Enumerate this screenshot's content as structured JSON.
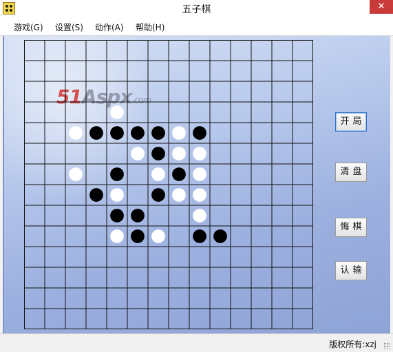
{
  "window": {
    "title": "五子棋",
    "close_glyph": "✕",
    "app_icon": "gomoku-board-icon"
  },
  "menu": {
    "items": [
      {
        "label": "游戏(G)"
      },
      {
        "label": "设置(S)"
      },
      {
        "label": "动作(A)"
      },
      {
        "label": "帮助(H)"
      }
    ]
  },
  "watermark": {
    "num": "51",
    "text": "Aspx",
    "domain": ".com"
  },
  "buttons": {
    "start": "开局",
    "clear": "清盘",
    "undo": "悔棋",
    "resign": "认输"
  },
  "status": {
    "text": "版权所有:xzj"
  },
  "board": {
    "size": 14,
    "grid_color": "#111111",
    "black_color": "#000000",
    "white_color": "#ffffff",
    "stones": [
      {
        "c": 4,
        "r": 3,
        "color": "white"
      },
      {
        "c": 2,
        "r": 4,
        "color": "white"
      },
      {
        "c": 3,
        "r": 4,
        "color": "black"
      },
      {
        "c": 4,
        "r": 4,
        "color": "black"
      },
      {
        "c": 5,
        "r": 4,
        "color": "black"
      },
      {
        "c": 6,
        "r": 4,
        "color": "black"
      },
      {
        "c": 7,
        "r": 4,
        "color": "white"
      },
      {
        "c": 8,
        "r": 4,
        "color": "black"
      },
      {
        "c": 5,
        "r": 5,
        "color": "white"
      },
      {
        "c": 6,
        "r": 5,
        "color": "black"
      },
      {
        "c": 7,
        "r": 5,
        "color": "white"
      },
      {
        "c": 8,
        "r": 5,
        "color": "white"
      },
      {
        "c": 2,
        "r": 6,
        "color": "white"
      },
      {
        "c": 4,
        "r": 6,
        "color": "black"
      },
      {
        "c": 6,
        "r": 6,
        "color": "white"
      },
      {
        "c": 7,
        "r": 6,
        "color": "black"
      },
      {
        "c": 8,
        "r": 6,
        "color": "white"
      },
      {
        "c": 3,
        "r": 7,
        "color": "black"
      },
      {
        "c": 4,
        "r": 7,
        "color": "white"
      },
      {
        "c": 6,
        "r": 7,
        "color": "black"
      },
      {
        "c": 7,
        "r": 7,
        "color": "white"
      },
      {
        "c": 8,
        "r": 7,
        "color": "white"
      },
      {
        "c": 4,
        "r": 8,
        "color": "black"
      },
      {
        "c": 5,
        "r": 8,
        "color": "black"
      },
      {
        "c": 8,
        "r": 8,
        "color": "white"
      },
      {
        "c": 4,
        "r": 9,
        "color": "white"
      },
      {
        "c": 5,
        "r": 9,
        "color": "black"
      },
      {
        "c": 6,
        "r": 9,
        "color": "white"
      },
      {
        "c": 8,
        "r": 9,
        "color": "black"
      },
      {
        "c": 9,
        "r": 9,
        "color": "black"
      }
    ]
  }
}
